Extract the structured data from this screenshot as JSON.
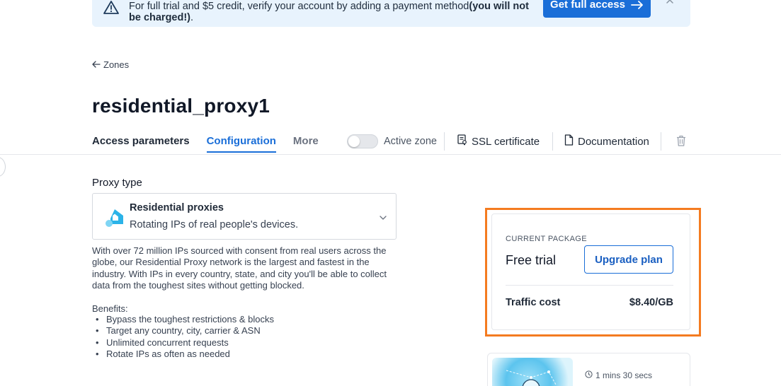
{
  "banner": {
    "text": "For full trial and $5 credit, verify your account by adding a payment method",
    "text_bold": "(you will not be charged!)",
    "text_end": ".",
    "button_label": "Get full access",
    "icon": "warning-icon",
    "close_icon": "close-icon"
  },
  "breadcrumb": {
    "label": "Zones",
    "icon": "arrow-left-icon"
  },
  "page": {
    "title": "residential_proxy1"
  },
  "tabs": [
    {
      "label": "Access parameters",
      "active": false
    },
    {
      "label": "Configuration",
      "active": true
    },
    {
      "label": "More",
      "active": false
    }
  ],
  "header_actions": {
    "toggle_label": "Active zone",
    "toggle_on": false,
    "ssl_label": "SSL certificate",
    "docs_label": "Documentation",
    "delete_icon": "trash-icon"
  },
  "proxy": {
    "section_label": "Proxy type",
    "selected_name": "Residential proxies",
    "selected_desc": "Rotating IPs of real people's devices.",
    "description": "With over 72 million IPs sourced with consent from real users across the globe, our Residential Proxy network is the largest and fastest in the industry. With IPs in every country, state, and city you'll be able to collect data from the toughest sites without getting blocked.",
    "benefits_title": "Benefits:",
    "benefits": [
      "Bypass the toughest restrictions & blocks",
      "Target any country, city, carrier & ASN",
      "Unlimited concurrent requests",
      "Rotate IPs as often as needed"
    ]
  },
  "package": {
    "label": "CURRENT PACKAGE",
    "name": "Free trial",
    "upgrade_label": "Upgrade plan",
    "cost_label": "Traffic cost",
    "cost_value": "$8.40/GB"
  },
  "video": {
    "duration": "1 mins 30 secs"
  },
  "colors": {
    "accent": "#1a6ed8",
    "banner_bg": "#e8f3fd",
    "highlight": "#f47b20"
  }
}
